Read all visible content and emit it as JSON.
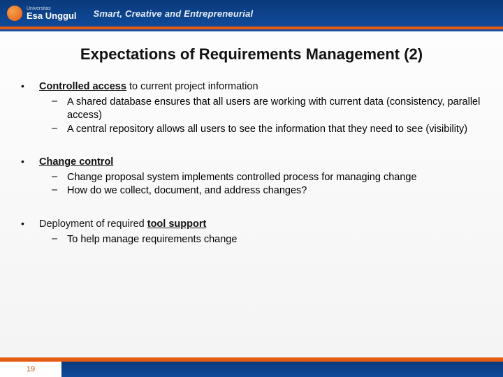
{
  "header": {
    "university_small": "Universitas",
    "university_name": "Esa Unggul",
    "tagline": "Smart, Creative and Entrepreneurial"
  },
  "title": "Expectations of Requirements Management (2)",
  "points": [
    {
      "lead_bold": "Controlled access",
      "lead_rest": " to current project information",
      "subs": [
        "A shared database ensures that all users are working with current data (consistency, parallel access)",
        "A central repository allows all users to see the information that they need to see (visibility)"
      ]
    },
    {
      "lead_bold": "Change control",
      "lead_rest": "",
      "subs": [
        "Change proposal system implements controlled process for managing change",
        "How do we collect, document, and address changes?"
      ]
    },
    {
      "lead_pre": "Deployment of required ",
      "lead_bold": "tool support",
      "lead_rest": "",
      "subs": [
        "To help manage requirements change"
      ]
    }
  ],
  "page_number": "19"
}
